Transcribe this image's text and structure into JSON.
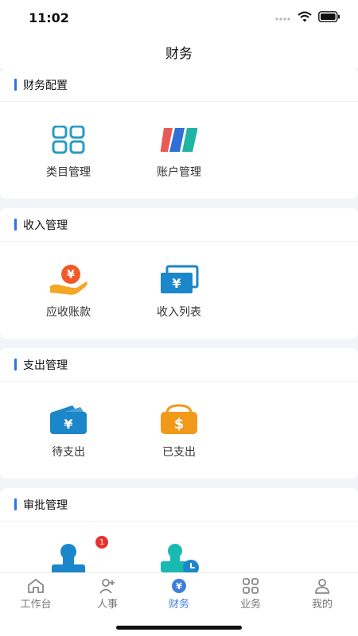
{
  "status": {
    "time": "11:02"
  },
  "nav": {
    "title": "财务"
  },
  "sections": [
    {
      "title": "财务配置",
      "items": [
        {
          "label": "类目管理",
          "icon": "grid-icon"
        },
        {
          "label": "账户管理",
          "icon": "account-cards-icon"
        }
      ]
    },
    {
      "title": "收入管理",
      "items": [
        {
          "label": "应收账款",
          "icon": "hand-coin-icon"
        },
        {
          "label": "收入列表",
          "icon": "yen-bills-icon"
        }
      ]
    },
    {
      "title": "支出管理",
      "items": [
        {
          "label": "待支出",
          "icon": "wallet-yen-icon"
        },
        {
          "label": "已支出",
          "icon": "wallet-dollar-icon"
        }
      ]
    },
    {
      "title": "审批管理",
      "items": [
        {
          "label": "",
          "icon": "stamp-icon",
          "badge": "1"
        },
        {
          "label": "",
          "icon": "stamp-clock-icon"
        }
      ]
    }
  ],
  "tabs": [
    {
      "label": "工作台",
      "icon": "home-icon"
    },
    {
      "label": "人事",
      "icon": "person-add-icon"
    },
    {
      "label": "财务",
      "icon": "yen-circle-icon",
      "active": true
    },
    {
      "label": "业务",
      "icon": "grid-icon"
    },
    {
      "label": "我的",
      "icon": "user-icon"
    }
  ],
  "colors": {
    "accent": "#2b74e2",
    "tab_active": "#3e7fdd",
    "badge": "#e8322f"
  }
}
